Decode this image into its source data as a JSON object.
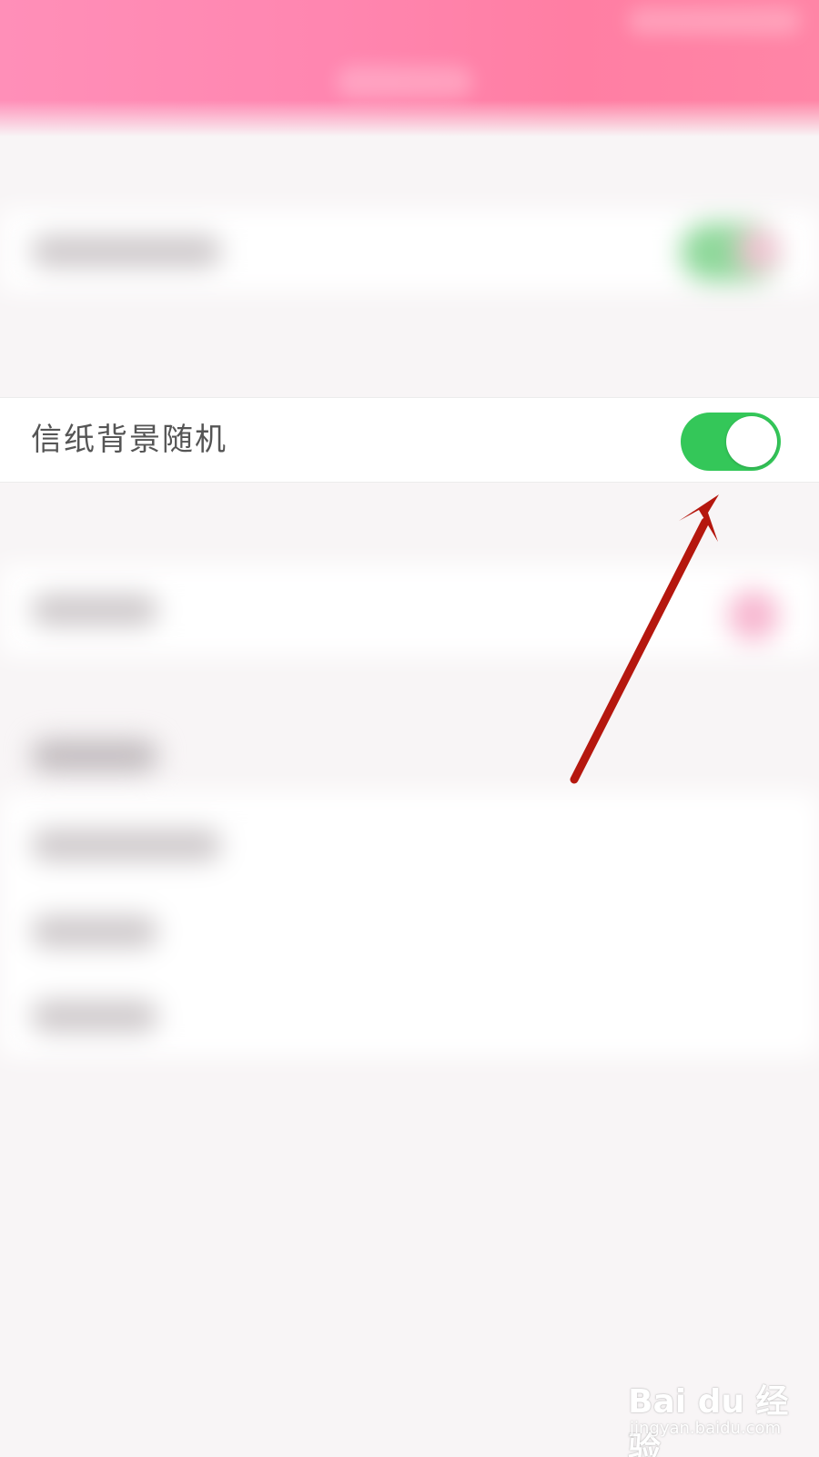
{
  "settings_row": {
    "label": "信纸背景随机",
    "toggle_on": true,
    "toggle_color": "#34c759"
  },
  "annotation": {
    "arrow_color": "#b5170e"
  },
  "watermark": {
    "logo_text": "Bai du 经验",
    "url": "jingyan.baidu.com"
  },
  "theme": {
    "header_color": "#ff86b0",
    "background": "#f8f5f6"
  }
}
